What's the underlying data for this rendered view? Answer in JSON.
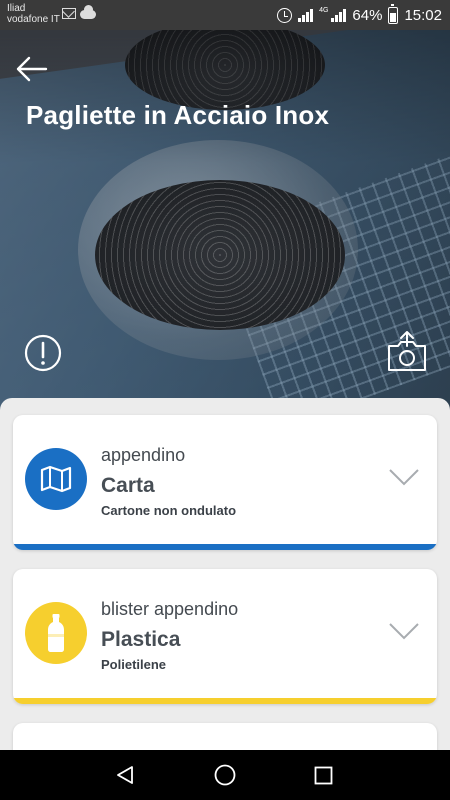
{
  "status_bar": {
    "carrier_line1": "Iliad",
    "carrier_line2": "vodafone IT",
    "network": "4G",
    "battery": "64%",
    "time": "15:02"
  },
  "header": {
    "title": "Pagliette in Acciaio Inox"
  },
  "icons": {
    "back": "arrow-left-icon",
    "report": "exclamation-circle-icon",
    "share": "camera-upload-icon",
    "carta": "map-icon",
    "plastica": "bottle-icon",
    "chevron": "chevron-down-icon"
  },
  "colors": {
    "carta": "#1a6fc4",
    "plastica": "#f6cf2e"
  },
  "components": [
    {
      "item": "appendino",
      "material": "Carta",
      "subtype": "Cartone non ondulato"
    },
    {
      "item": "blister appendino",
      "material": "Plastica",
      "subtype": "Polietilene"
    }
  ]
}
